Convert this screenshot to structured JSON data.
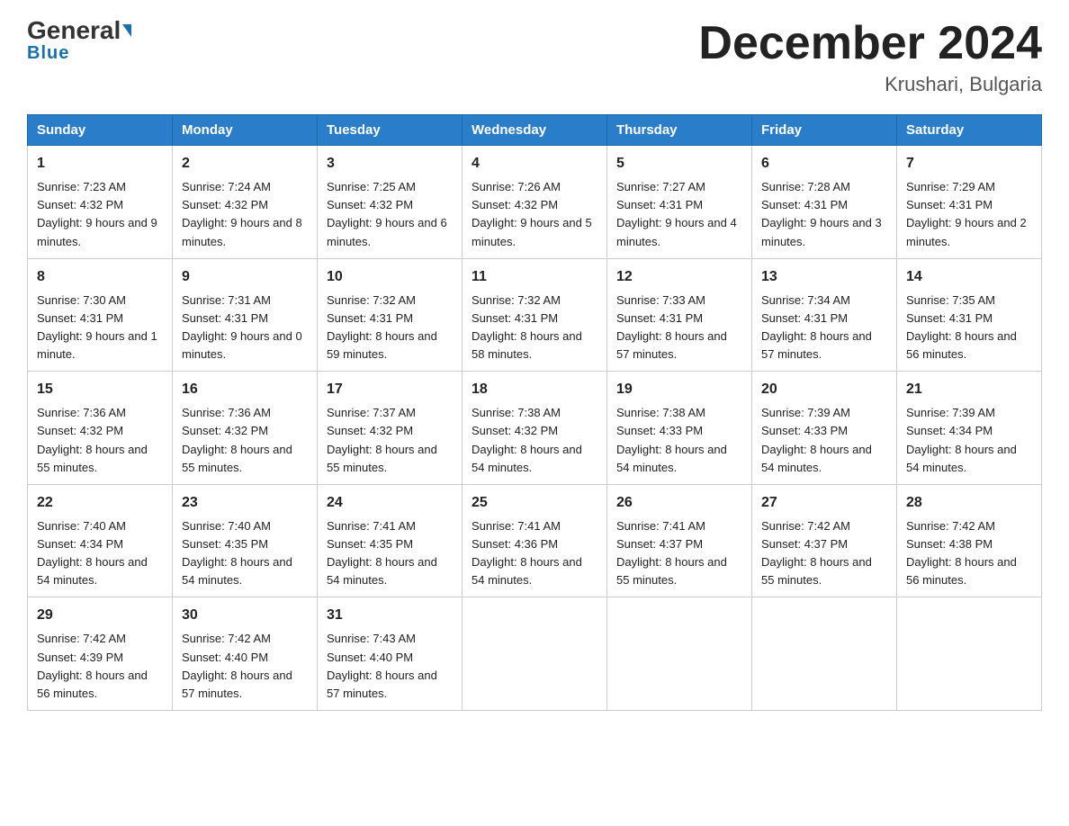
{
  "header": {
    "logo_line1": "General",
    "logo_line2": "Blue",
    "month_title": "December 2024",
    "location": "Krushari, Bulgaria"
  },
  "days_of_week": [
    "Sunday",
    "Monday",
    "Tuesday",
    "Wednesday",
    "Thursday",
    "Friday",
    "Saturday"
  ],
  "weeks": [
    [
      {
        "day": "1",
        "sunrise": "7:23 AM",
        "sunset": "4:32 PM",
        "daylight": "9 hours and 9 minutes."
      },
      {
        "day": "2",
        "sunrise": "7:24 AM",
        "sunset": "4:32 PM",
        "daylight": "9 hours and 8 minutes."
      },
      {
        "day": "3",
        "sunrise": "7:25 AM",
        "sunset": "4:32 PM",
        "daylight": "9 hours and 6 minutes."
      },
      {
        "day": "4",
        "sunrise": "7:26 AM",
        "sunset": "4:32 PM",
        "daylight": "9 hours and 5 minutes."
      },
      {
        "day": "5",
        "sunrise": "7:27 AM",
        "sunset": "4:31 PM",
        "daylight": "9 hours and 4 minutes."
      },
      {
        "day": "6",
        "sunrise": "7:28 AM",
        "sunset": "4:31 PM",
        "daylight": "9 hours and 3 minutes."
      },
      {
        "day": "7",
        "sunrise": "7:29 AM",
        "sunset": "4:31 PM",
        "daylight": "9 hours and 2 minutes."
      }
    ],
    [
      {
        "day": "8",
        "sunrise": "7:30 AM",
        "sunset": "4:31 PM",
        "daylight": "9 hours and 1 minute."
      },
      {
        "day": "9",
        "sunrise": "7:31 AM",
        "sunset": "4:31 PM",
        "daylight": "9 hours and 0 minutes."
      },
      {
        "day": "10",
        "sunrise": "7:32 AM",
        "sunset": "4:31 PM",
        "daylight": "8 hours and 59 minutes."
      },
      {
        "day": "11",
        "sunrise": "7:32 AM",
        "sunset": "4:31 PM",
        "daylight": "8 hours and 58 minutes."
      },
      {
        "day": "12",
        "sunrise": "7:33 AM",
        "sunset": "4:31 PM",
        "daylight": "8 hours and 57 minutes."
      },
      {
        "day": "13",
        "sunrise": "7:34 AM",
        "sunset": "4:31 PM",
        "daylight": "8 hours and 57 minutes."
      },
      {
        "day": "14",
        "sunrise": "7:35 AM",
        "sunset": "4:31 PM",
        "daylight": "8 hours and 56 minutes."
      }
    ],
    [
      {
        "day": "15",
        "sunrise": "7:36 AM",
        "sunset": "4:32 PM",
        "daylight": "8 hours and 55 minutes."
      },
      {
        "day": "16",
        "sunrise": "7:36 AM",
        "sunset": "4:32 PM",
        "daylight": "8 hours and 55 minutes."
      },
      {
        "day": "17",
        "sunrise": "7:37 AM",
        "sunset": "4:32 PM",
        "daylight": "8 hours and 55 minutes."
      },
      {
        "day": "18",
        "sunrise": "7:38 AM",
        "sunset": "4:32 PM",
        "daylight": "8 hours and 54 minutes."
      },
      {
        "day": "19",
        "sunrise": "7:38 AM",
        "sunset": "4:33 PM",
        "daylight": "8 hours and 54 minutes."
      },
      {
        "day": "20",
        "sunrise": "7:39 AM",
        "sunset": "4:33 PM",
        "daylight": "8 hours and 54 minutes."
      },
      {
        "day": "21",
        "sunrise": "7:39 AM",
        "sunset": "4:34 PM",
        "daylight": "8 hours and 54 minutes."
      }
    ],
    [
      {
        "day": "22",
        "sunrise": "7:40 AM",
        "sunset": "4:34 PM",
        "daylight": "8 hours and 54 minutes."
      },
      {
        "day": "23",
        "sunrise": "7:40 AM",
        "sunset": "4:35 PM",
        "daylight": "8 hours and 54 minutes."
      },
      {
        "day": "24",
        "sunrise": "7:41 AM",
        "sunset": "4:35 PM",
        "daylight": "8 hours and 54 minutes."
      },
      {
        "day": "25",
        "sunrise": "7:41 AM",
        "sunset": "4:36 PM",
        "daylight": "8 hours and 54 minutes."
      },
      {
        "day": "26",
        "sunrise": "7:41 AM",
        "sunset": "4:37 PM",
        "daylight": "8 hours and 55 minutes."
      },
      {
        "day": "27",
        "sunrise": "7:42 AM",
        "sunset": "4:37 PM",
        "daylight": "8 hours and 55 minutes."
      },
      {
        "day": "28",
        "sunrise": "7:42 AM",
        "sunset": "4:38 PM",
        "daylight": "8 hours and 56 minutes."
      }
    ],
    [
      {
        "day": "29",
        "sunrise": "7:42 AM",
        "sunset": "4:39 PM",
        "daylight": "8 hours and 56 minutes."
      },
      {
        "day": "30",
        "sunrise": "7:42 AM",
        "sunset": "4:40 PM",
        "daylight": "8 hours and 57 minutes."
      },
      {
        "day": "31",
        "sunrise": "7:43 AM",
        "sunset": "4:40 PM",
        "daylight": "8 hours and 57 minutes."
      },
      null,
      null,
      null,
      null
    ]
  ],
  "labels": {
    "sunrise": "Sunrise:",
    "sunset": "Sunset:",
    "daylight": "Daylight:"
  }
}
